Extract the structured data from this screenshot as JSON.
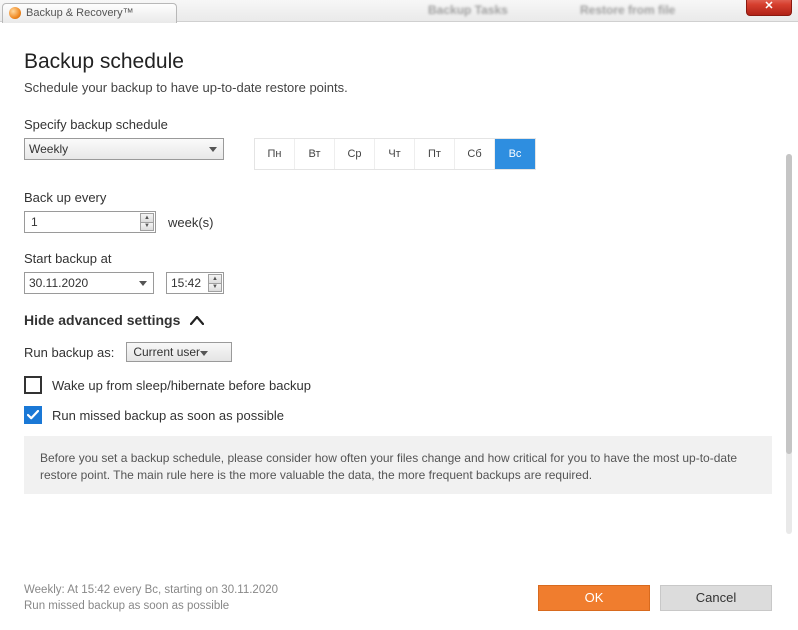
{
  "titlebar": {
    "tab_label": "Backup & Recovery™",
    "blurred1": "Backup Tasks",
    "blurred2": "Restore from file"
  },
  "header": {
    "title": "Backup schedule",
    "subtitle": "Schedule your backup to have up-to-date restore points."
  },
  "schedule": {
    "label": "Specify backup schedule",
    "mode": "Weekly",
    "days": [
      "Пн",
      "Вт",
      "Ср",
      "Чт",
      "Пт",
      "Сб",
      "Вс"
    ],
    "selected_day_index": 6
  },
  "every": {
    "label": "Back up every",
    "value": "1",
    "unit": "week(s)"
  },
  "start": {
    "label": "Start backup at",
    "date": "30.11.2020",
    "time": "15:42"
  },
  "advanced": {
    "toggle_label": "Hide advanced settings",
    "run_as_label": "Run backup as:",
    "run_as_value": "Current user"
  },
  "options": {
    "wake_label": "Wake up from sleep/hibernate before backup",
    "wake_checked": false,
    "missed_label": "Run missed backup as soon as possible",
    "missed_checked": true
  },
  "info": "Before you set a backup schedule, please consider how often your files change and how critical for you to have the most up-to-date restore point. The main rule here is the more valuable the data, the more frequent backups are required.",
  "footer": {
    "summary_line1": "Weekly: At 15:42 every Вс, starting on 30.11.2020",
    "summary_line2": "Run missed backup as soon as possible",
    "ok": "OK",
    "cancel": "Cancel"
  }
}
